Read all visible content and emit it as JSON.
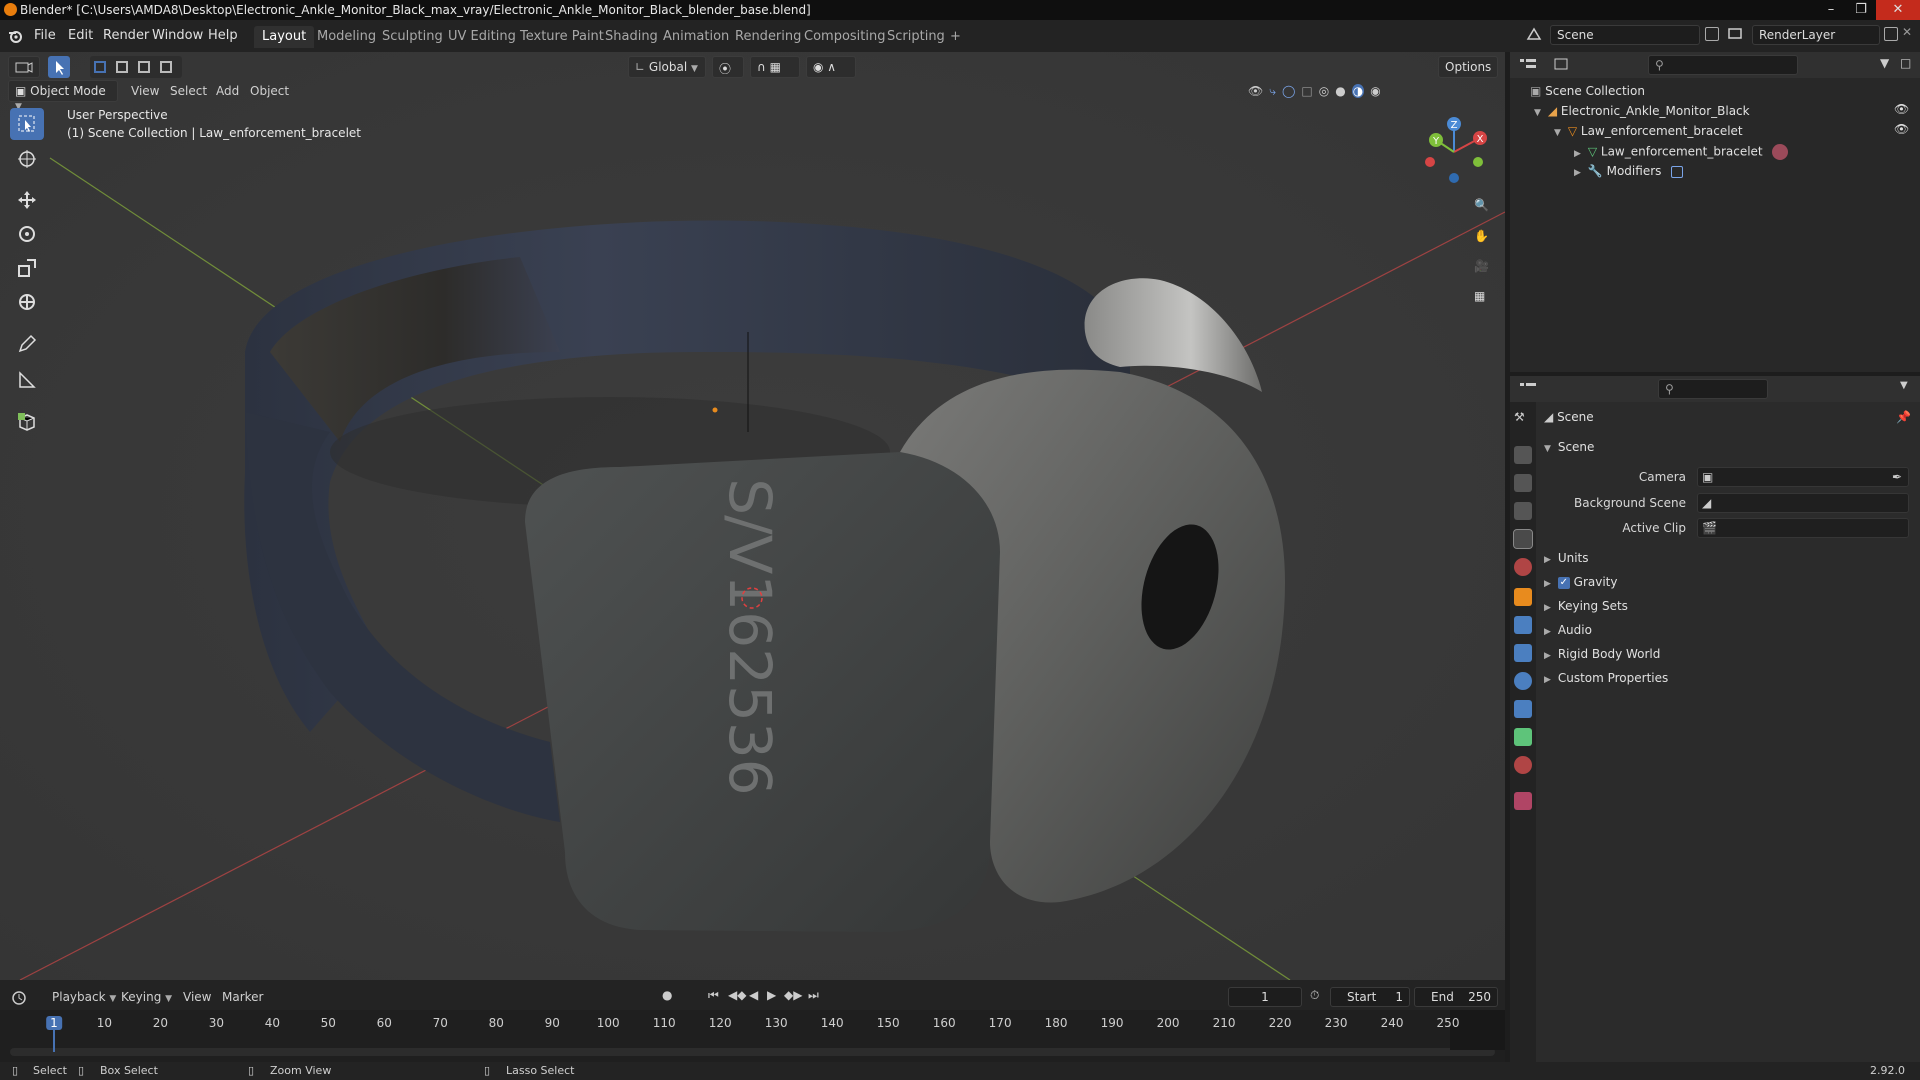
{
  "window": {
    "title": "Blender* [C:\\Users\\AMDA8\\Desktop\\Electronic_Ankle_Monitor_Black_max_vray/Electronic_Ankle_Monitor_Black_blender_base.blend]"
  },
  "menu": {
    "items": [
      "File",
      "Edit",
      "Render",
      "Window",
      "Help"
    ],
    "workspaces": [
      "Layout",
      "Modeling",
      "Sculpting",
      "UV Editing",
      "Texture Paint",
      "Shading",
      "Animation",
      "Rendering",
      "Compositing",
      "Scripting",
      "+"
    ],
    "active_workspace": "Layout",
    "scene_name": "Scene",
    "view_layer": "RenderLayer"
  },
  "viewport": {
    "mode": "Object Mode",
    "menus": [
      "View",
      "Select",
      "Add",
      "Object"
    ],
    "transform_orientation": "Global",
    "options_label": "Options",
    "perspective_label": "User Perspective",
    "collection_label": "(1) Scene Collection | Law_enforcement_bracelet",
    "serial_text": "S/V162536",
    "gizmo": {
      "x": "X",
      "y": "Y",
      "z": "Z"
    },
    "colors": {
      "background": "#393939",
      "x_axis": "#b84545",
      "y_axis": "#7fa33a",
      "active_tool": "#4772b3"
    }
  },
  "outliner": {
    "root": "Scene Collection",
    "items": [
      {
        "label": "Electronic_Ankle_Monitor_Black",
        "icon": "collection-icon"
      },
      {
        "label": "Law_enforcement_bracelet",
        "icon": "object-icon"
      },
      {
        "label": "Law_enforcement_bracelet",
        "icon": "mesh-icon"
      },
      {
        "label": "Modifiers",
        "icon": "wrench-icon"
      }
    ]
  },
  "properties": {
    "context": "Scene",
    "panel_title": "Scene",
    "fields": [
      {
        "label": "Camera",
        "value": ""
      },
      {
        "label": "Background Scene",
        "value": ""
      },
      {
        "label": "Active Clip",
        "value": ""
      }
    ],
    "panels": [
      "Units",
      "Gravity",
      "Keying Sets",
      "Audio",
      "Rigid Body World",
      "Custom Properties"
    ],
    "gravity_checked": true
  },
  "timeline": {
    "menus": [
      "Playback",
      "Keying",
      "View",
      "Marker"
    ],
    "current_frame": "1",
    "start_label": "Start",
    "start": "1",
    "end_label": "End",
    "end": "250",
    "ticks": [
      "1",
      "10",
      "20",
      "30",
      "40",
      "50",
      "60",
      "70",
      "80",
      "90",
      "100",
      "110",
      "120",
      "130",
      "140",
      "150",
      "160",
      "170",
      "180",
      "190",
      "200",
      "210",
      "220",
      "230",
      "240",
      "250"
    ]
  },
  "status": {
    "select": "Select",
    "box_select": "Box Select",
    "zoom_view": "Zoom View",
    "lasso_select": "Lasso Select",
    "version": "2.92.0"
  }
}
